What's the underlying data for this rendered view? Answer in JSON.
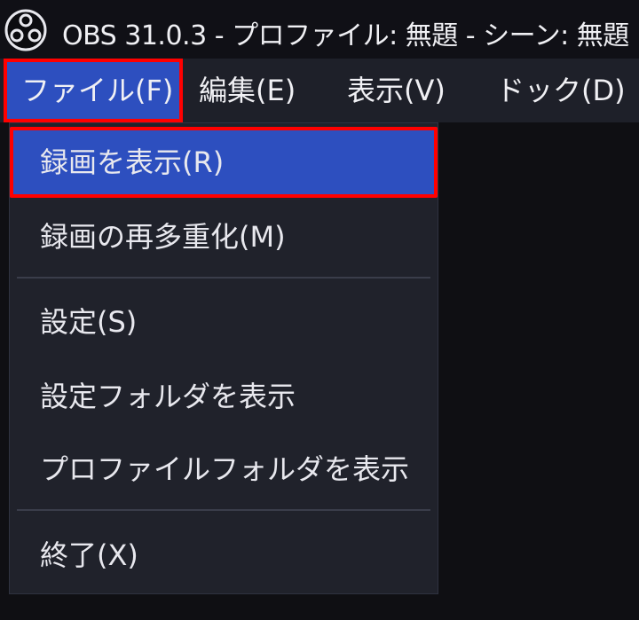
{
  "window": {
    "title": "OBS 31.0.3 - プロファイル: 無題 - シーン: 無題",
    "app_icon": "obs-logo-icon"
  },
  "menubar": {
    "items": [
      {
        "label": "ファイル(F)",
        "active": true
      },
      {
        "label": "編集(E)"
      },
      {
        "label": "表示(V)"
      },
      {
        "label": "ドック(D)"
      }
    ]
  },
  "file_menu": {
    "items": [
      {
        "label": "録画を表示(R)",
        "highlighted": true
      },
      {
        "label": "録画の再多重化(M)"
      },
      {
        "label": "設定(S)"
      },
      {
        "label": "設定フォルダを表示"
      },
      {
        "label": "プロファイルフォルダを表示"
      },
      {
        "label": "終了(X)"
      }
    ]
  },
  "colors": {
    "highlight": "#2d4fbf",
    "annotation_border": "#ff0000",
    "menu_background": "#20222b",
    "menubar_background": "#1e2029",
    "titlebar_background": "#101016"
  }
}
